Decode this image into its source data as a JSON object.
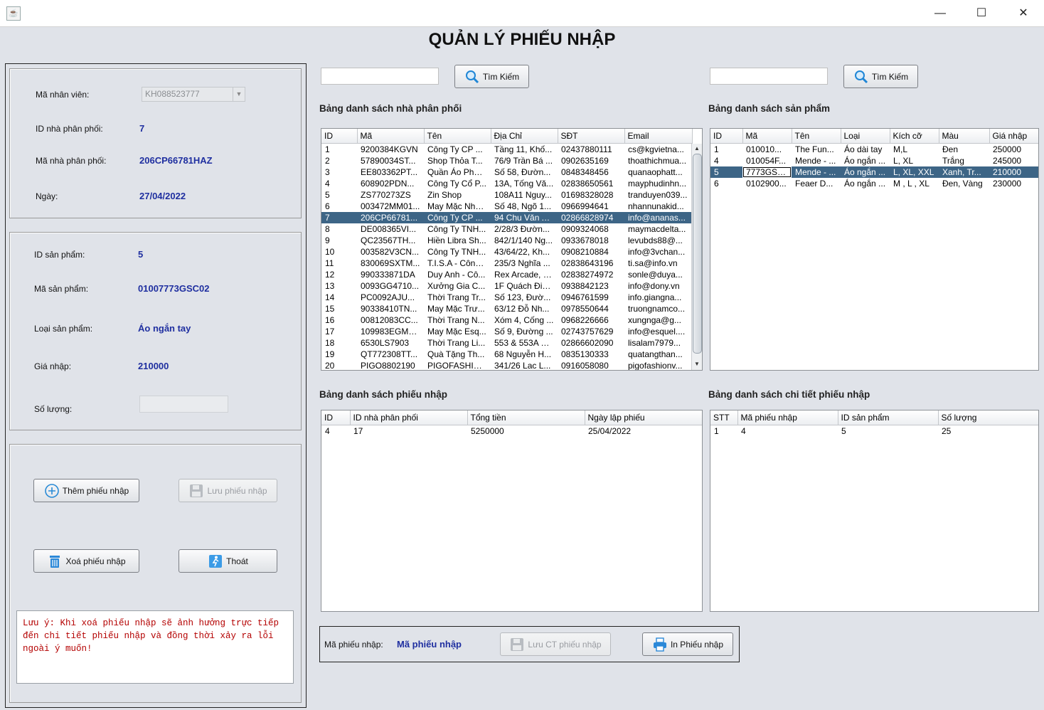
{
  "window": {
    "minimize_glyph": "—",
    "maximize_glyph": "☐",
    "close_glyph": "✕",
    "icon_glyph": "☕"
  },
  "page_title": "QUẢN LÝ PHIẾU NHẬP",
  "left": {
    "employee_label": "Mã nhân viên:",
    "employee_value": "KH088523777",
    "distributor_id_label": "ID nhà phân phối:",
    "distributor_id_value": "7",
    "distributor_code_label": "Mã nhà phân phối:",
    "distributor_code_value": "206CP66781HAZ",
    "date_label": "Ngày:",
    "date_value": "27/04/2022",
    "product_id_label": "ID sản phẩm:",
    "product_id_value": "5",
    "product_code_label": "Mã sản phẩm:",
    "product_code_value": "01007773GSC02",
    "product_type_label": "Loại sản phẩm:",
    "product_type_value": "Áo ngắn tay",
    "price_label": "Giá nhập:",
    "price_value": "210000",
    "quantity_label": "Số lượng:",
    "quantity_value": "",
    "buttons": {
      "add": "Thêm phiếu nhập",
      "save": "Lưu phiếu nhập",
      "delete": "Xoá phiếu nhập",
      "exit": "Thoát"
    },
    "note": "Lưu ý: Khi xoá phiếu nhập sẽ ảnh hưởng trực tiếp đến chi tiết phiếu nhập và đồng thời xảy ra lỗi ngoài ý muốn!"
  },
  "search1": {
    "value": "",
    "button": "Tìm Kiếm"
  },
  "search2": {
    "value": "",
    "button": "Tìm Kiếm"
  },
  "distributors": {
    "title": "Bảng danh sách nhà phân phối",
    "columns": [
      "ID",
      "Mã",
      "Tên",
      "Địa Chỉ",
      "SĐT",
      "Email"
    ],
    "selected_index": 6,
    "rows": [
      [
        "1",
        "9200384KGVN",
        "Công Ty CP ...",
        "Tầng 11, Khố...",
        "02437880111",
        "cs@kgvietna..."
      ],
      [
        "2",
        "57890034ST...",
        "Shop Thỏa T...",
        "76/9 Trần Bá ...",
        "0902635169",
        "thoathichmua..."
      ],
      [
        "3",
        "EE803362PT...",
        "Quần Áo Phát...",
        "Số 58, Đườn...",
        "0848348456",
        "quanaophatt..."
      ],
      [
        "4",
        "608902PDN...",
        "Công Ty Cổ P...",
        "13A, Tống Vă...",
        "02838650561",
        "mayphudinhn..."
      ],
      [
        "5",
        "ZS770273ZS",
        "Zin Shop",
        "108A11 Nguy...",
        "01698328028",
        "tranduyen039..."
      ],
      [
        "6",
        "003472MM01...",
        "May Mặc Nhà...",
        "Số 48, Ngõ 1...",
        "0966994641",
        "nhannunakid..."
      ],
      [
        "7",
        "206CP66781...",
        "Công Ty CP ...",
        "94 Chu Văn A...",
        "02866828974",
        "info@ananas..."
      ],
      [
        "8",
        "DE008365VI...",
        "Công Ty TNH...",
        "2/28/3 Đườn...",
        "0909324068",
        "maymacdelta..."
      ],
      [
        "9",
        "QC23567TH...",
        "Hiền Libra Sh...",
        "842/1/140 Ng...",
        "0933678018",
        "levubds88@..."
      ],
      [
        "10",
        "003582V3CN...",
        "Công Ty TNH...",
        "43/64/22, Kh...",
        "0908210884",
        "info@3vchan..."
      ],
      [
        "11",
        "830069SXTM...",
        "T.I.S.A - Công...",
        "235/3 Nghĩa ...",
        "02838643196",
        "ti.sa@info.vn"
      ],
      [
        "12",
        "990333871DA",
        "Duy Anh - Cô...",
        "Rex Arcade, 4...",
        "02838274972",
        "sonle@duya..."
      ],
      [
        "13",
        "0093GG4710...",
        "Xưởng Gia C...",
        "1F Quách Điề...",
        "0938842123",
        "info@dony.vn"
      ],
      [
        "14",
        "PC0092AJU...",
        "Thời Trang Tr...",
        "Số 123, Đườ...",
        "0946761599",
        "info.giangna..."
      ],
      [
        "15",
        "90338410TN...",
        "May Mặc Trư...",
        "63/12 Đỗ Nh...",
        "0978550644",
        "truongnamco..."
      ],
      [
        "16",
        "00812083CC...",
        "Thời Trang N...",
        "Xóm 4, Cống ...",
        "0968226666",
        "xungnga@g..."
      ],
      [
        "17",
        "109983EGMVN",
        "May Mặc Esq...",
        "Số 9, Đường ...",
        "02743757629",
        "info@esquel...."
      ],
      [
        "18",
        "6530LS7903",
        "Thời Trang Li...",
        "553 & 553A N...",
        "02866602090",
        "lisalam7979..."
      ],
      [
        "19",
        "QT772308TT...",
        "Quà Tặng Th...",
        "68 Nguyễn H...",
        "0835130333",
        "quatangthan..."
      ],
      [
        "20",
        "PIGO8802190",
        "PIGOFASHIO...",
        "341/26 Lac L...",
        "0916058080",
        "pigofashionv..."
      ]
    ]
  },
  "products": {
    "title": "Bảng danh sách sản phẩm",
    "columns": [
      "ID",
      "Mã",
      "Tên",
      "Loại",
      "Kích cỡ",
      "Màu",
      "Giá nhập"
    ],
    "selected_index": 2,
    "rows": [
      [
        "1",
        "010010...",
        "The Fun...",
        "Áo dài tay",
        "M,L",
        "Đen",
        "250000"
      ],
      [
        "4",
        "010054F...",
        "Mende - ...",
        "Áo ngắn ...",
        "L, XL",
        "Trắng",
        "245000"
      ],
      [
        "5",
        "7773GSC02",
        "Mende - ...",
        "Áo ngắn ...",
        "L, XL, XXL",
        "Xanh, Tr...",
        "210000"
      ],
      [
        "6",
        "0102900...",
        "Feaer D...",
        "Áo ngắn ...",
        "M , L , XL",
        "Đen, Vàng",
        "230000"
      ]
    ]
  },
  "receipts": {
    "title": "Bảng danh sách phiếu nhập",
    "columns": [
      "ID",
      "ID nhà phân phối",
      "Tổng tiền",
      "Ngày lập phiếu"
    ],
    "rows": [
      [
        "4",
        "17",
        "5250000",
        "25/04/2022"
      ]
    ]
  },
  "receipt_details": {
    "title": "Bảng danh sách chi tiết phiếu nhập",
    "columns": [
      "STT",
      "Mã phiếu nhập",
      "ID sản phẩm",
      "Số lượng"
    ],
    "rows": [
      [
        "1",
        "4",
        "5",
        "25"
      ]
    ]
  },
  "bottom": {
    "code_label": "Mã phiếu nhập:",
    "code_value": "Mã phiếu nhập",
    "save_detail": "Lưu CT phiếu nhập",
    "print": "In Phiếu nhập"
  },
  "colors": {
    "selected_row": "#3d6586",
    "value_text": "#1f2fa0",
    "note_text": "#b40000"
  }
}
